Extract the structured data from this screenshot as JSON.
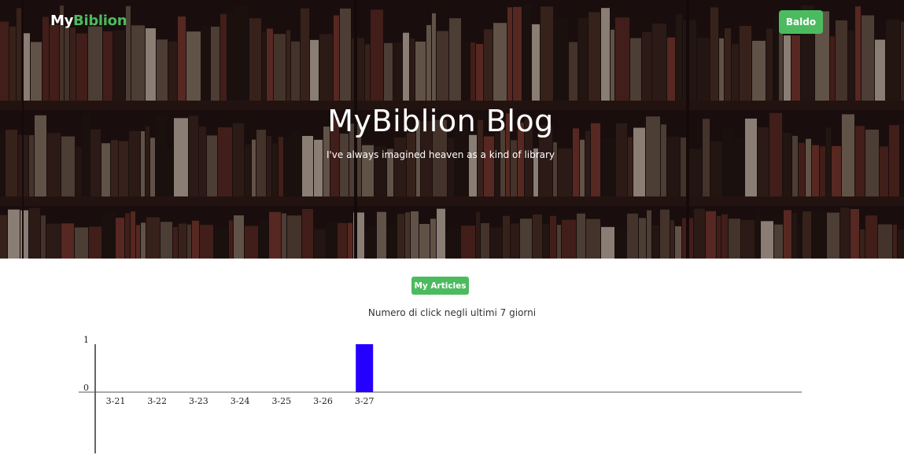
{
  "navbar": {
    "brand_my": "My",
    "brand_biblion": "Biblion",
    "user_button": "Baldo"
  },
  "hero": {
    "title": "MyBiblion Blog",
    "subtitle": "I've always imagined heaven as a kind of library"
  },
  "content": {
    "articles_button": "My Articles",
    "chart_title": "Numero di click negli ultimi 7 giorni"
  },
  "colors": {
    "accent": "#4cbb5f",
    "bar": "#2600ff"
  },
  "chart_data": {
    "type": "bar",
    "title": "Numero di click negli ultimi 7 giorni",
    "categories": [
      "3-21",
      "3-22",
      "3-23",
      "3-24",
      "3-25",
      "3-26",
      "3-27"
    ],
    "values": [
      0,
      0,
      0,
      0,
      0,
      0,
      1
    ],
    "y_ticks": [
      0,
      1
    ],
    "ylim": [
      0,
      1
    ],
    "xlabel": "",
    "ylabel": ""
  }
}
